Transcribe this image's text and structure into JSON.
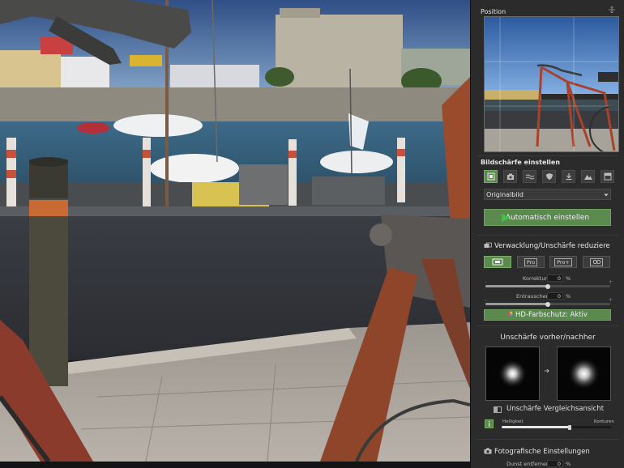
{
  "panel": {
    "position_title": "Position",
    "sharpen_title": "Bildschärfe einstellen",
    "dropdown_value": "Originalbild",
    "auto_button": "Automatisch einstellen",
    "shake_title": "Verwacklung/Unschärfe reduziere",
    "modes": [
      "",
      "Pro",
      "Pro+",
      "OO"
    ],
    "korrektur_label": "Korrektur",
    "korrektur_value": "0",
    "entrauschen_label": "Entrauschen",
    "entrauschen_value": "0",
    "percent": "%",
    "hd_button": "HD-Farbschutz: Aktiv",
    "compare_title": "Unschärfe vorher/nachher",
    "compare_view": "Unschärfe Vergleichsansicht",
    "helligkeit_label": "Helligkeit",
    "konturen_label": "Konturen",
    "photo_title": "Fotografische Einstellungen",
    "dunst_label": "Dunst entfernen",
    "dunst_value": "0",
    "korrektur_level": 0.5,
    "entrauschen_level": 0.5,
    "helligkeit_level": 0.62
  },
  "icons": {
    "expand": "expand-icon",
    "tools": [
      "sharpen-photo-icon",
      "camera-icon",
      "waves-icon",
      "shield-icon",
      "download-icon",
      "mountain-icon",
      "image-icon"
    ],
    "shake": "shake-icon",
    "info": "info-icon",
    "photo": "photo-settings-icon",
    "arrow": "arrow-right-icon"
  },
  "colors": {
    "accent": "#5b8a4e",
    "panel_bg": "#2b2b2b"
  }
}
